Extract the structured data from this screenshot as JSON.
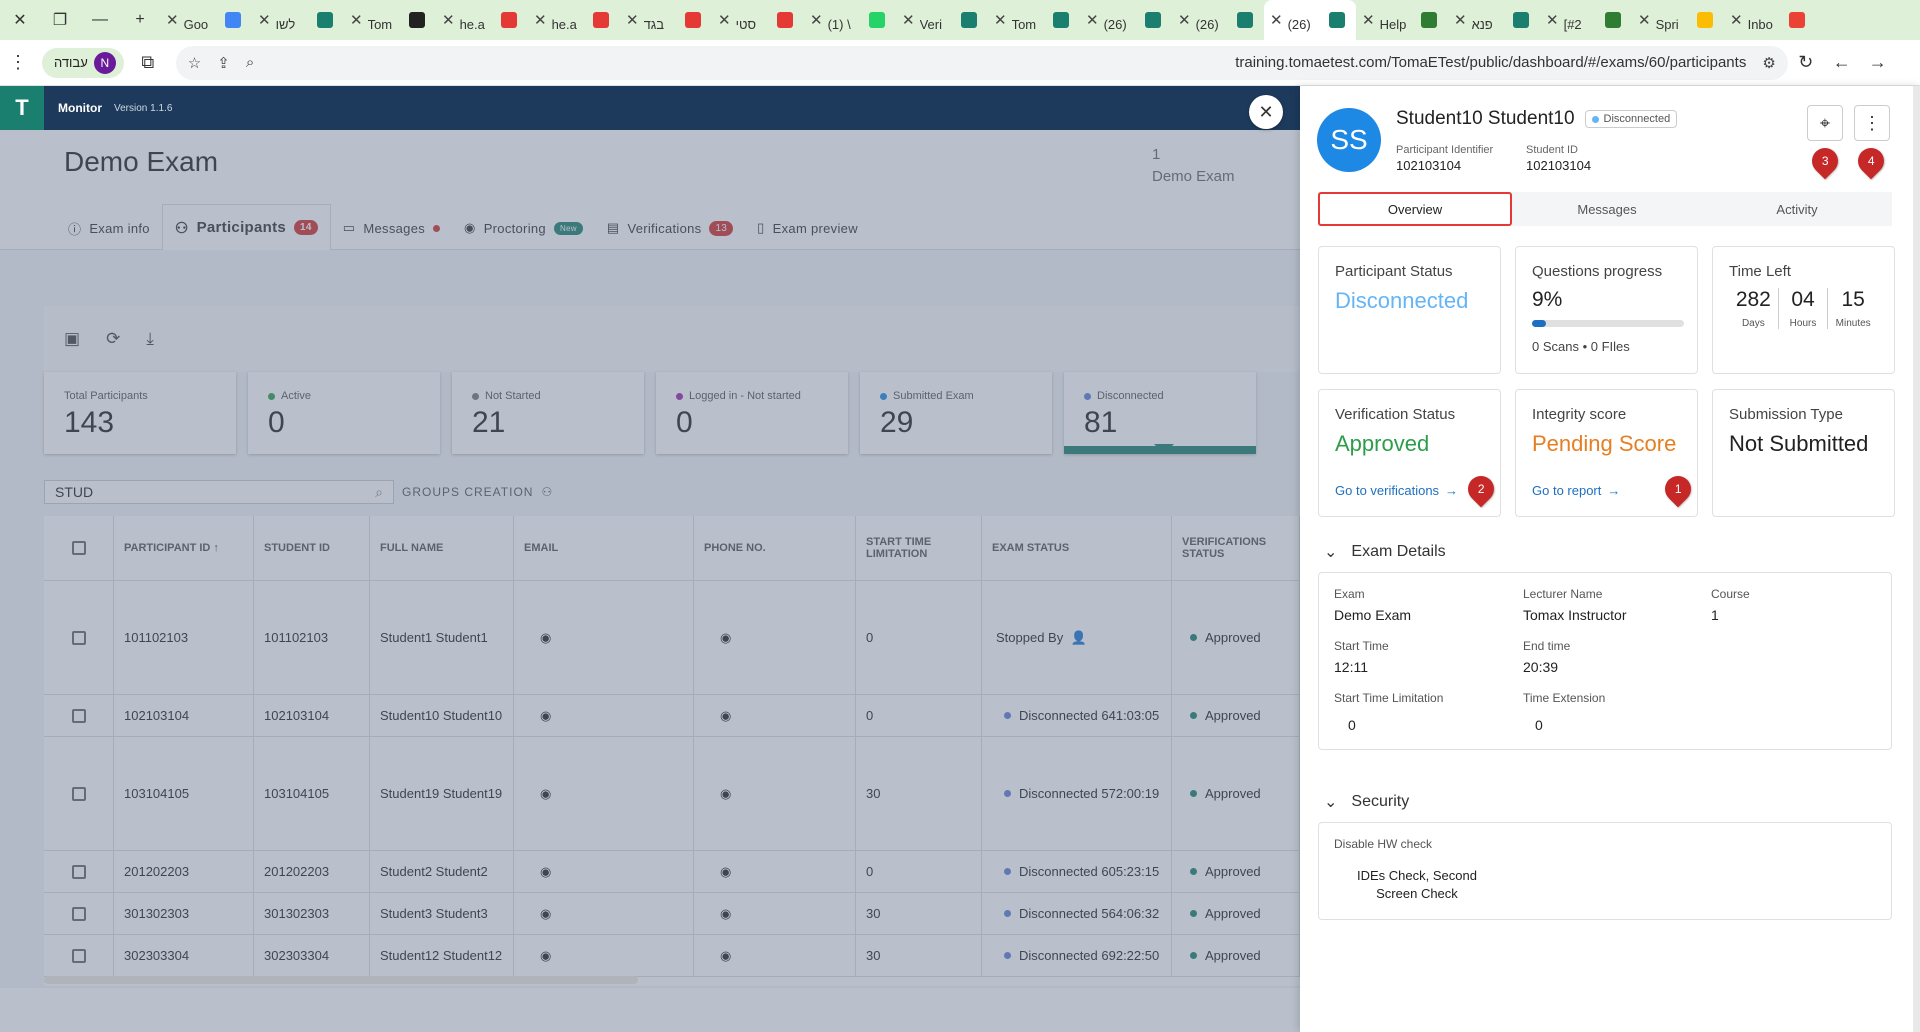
{
  "browser": {
    "tabs": [
      {
        "label": "Goo",
        "color": "#4285f4"
      },
      {
        "label": "לשו",
        "color": "#1a7f6e"
      },
      {
        "label": "Tom",
        "color": "#222222"
      },
      {
        "label": "he.a",
        "color": "#e53935"
      },
      {
        "label": "he.a",
        "color": "#e53935"
      },
      {
        "label": "בגד",
        "color": "#e53935"
      },
      {
        "label": "סטי",
        "color": "#e53935"
      },
      {
        "label": "(1) \\",
        "color": "#25d366"
      },
      {
        "label": "Veri",
        "color": "#1a7f6e"
      },
      {
        "label": "Tom",
        "color": "#1a7f6e"
      },
      {
        "label": "(26)",
        "color": "#1a7f6e"
      },
      {
        "label": "(26)",
        "color": "#1a7f6e"
      },
      {
        "label": "(26)",
        "color": "#1a7f6e",
        "active": true
      },
      {
        "label": "Help",
        "color": "#2e7d32"
      },
      {
        "label": "פנא",
        "color": "#1a7f6e"
      },
      {
        "label": "[#2",
        "color": "#2e7d32"
      },
      {
        "label": "Spri",
        "color": "#fbbc04"
      },
      {
        "label": "Inbo",
        "color": "#ea4335"
      }
    ],
    "profile_label": "עבודה",
    "profile_initial": "N",
    "url": "training.tomaetest.com/TomaETest/public/dashboard/#/exams/60/participants"
  },
  "app": {
    "nav_title": "Monitor",
    "version": "Version 1.1.6",
    "exam_title": "Demo Exam",
    "exam_meta_num": "1",
    "exam_meta_name": "Demo Exam",
    "tabs": [
      {
        "label": "Exam info"
      },
      {
        "label": "Participants",
        "badge": "14"
      },
      {
        "label": "Messages"
      },
      {
        "label": "Proctoring",
        "badge": "New"
      },
      {
        "label": "Verifications",
        "badge": "13"
      },
      {
        "label": "Exam preview"
      }
    ],
    "stats": [
      {
        "label": "Total Participants",
        "value": "143",
        "color": ""
      },
      {
        "label": "Active",
        "value": "0",
        "color": "#2e9d4a"
      },
      {
        "label": "Not Started",
        "value": "21",
        "color": "#777777"
      },
      {
        "label": "Logged in - Not started",
        "value": "0",
        "color": "#9c27b0"
      },
      {
        "label": "Submitted Exam",
        "value": "29",
        "color": "#1e88e5"
      },
      {
        "label": "Disconnected",
        "value": "81",
        "color": "#5b7fd6"
      }
    ],
    "search_value": "STUD",
    "groups_label": "GROUPS CREATION",
    "columns": [
      "PARTICIPANT ID",
      "STUDENT ID",
      "FULL NAME",
      "EMAIL",
      "PHONE NO.",
      "START TIME LIMITATION",
      "EXAM STATUS",
      "VERIFICATIONS STATUS"
    ],
    "rows": [
      {
        "pid": "101102103",
        "sid": "101102103",
        "name": "Student1 Student1",
        "stl": "0",
        "status": "Stopped By",
        "verif": "Approved"
      },
      {
        "pid": "102103104",
        "sid": "102103104",
        "name": "Student10 Student10",
        "stl": "0",
        "status": "Disconnected 641:03:05",
        "verif": "Approved"
      },
      {
        "pid": "103104105",
        "sid": "103104105",
        "name": "Student19 Student19",
        "stl": "30",
        "status": "Disconnected 572:00:19",
        "verif": "Approved"
      },
      {
        "pid": "201202203",
        "sid": "201202203",
        "name": "Student2 Student2",
        "stl": "0",
        "status": "Disconnected 605:23:15",
        "verif": "Approved"
      },
      {
        "pid": "301302303",
        "sid": "301302303",
        "name": "Student3 Student3",
        "stl": "30",
        "status": "Disconnected 564:06:32",
        "verif": "Approved"
      },
      {
        "pid": "302303304",
        "sid": "302303304",
        "name": "Student12 Student12",
        "stl": "30",
        "status": "Disconnected 692:22:50",
        "verif": "Approved"
      }
    ]
  },
  "panel": {
    "initials": "SS",
    "name": "Student10 Student10",
    "status_pill": "Disconnected",
    "participant_identifier_label": "Participant Identifier",
    "participant_identifier": "102103104",
    "student_id_label": "Student ID",
    "student_id": "102103104",
    "tabs": [
      "Overview",
      "Messages",
      "Activity"
    ],
    "participant_status_title": "Participant Status",
    "participant_status": "Disconnected",
    "questions_title": "Questions progress",
    "questions_pct": "9%",
    "questions_fraction": 0.09,
    "scans": "0 Scans",
    "files": "0 FIles",
    "time_left_title": "Time Left",
    "time_left": [
      {
        "n": "282",
        "l": "Days"
      },
      {
        "n": "04",
        "l": "Hours"
      },
      {
        "n": "15",
        "l": "Minutes"
      }
    ],
    "verification_title": "Verification Status",
    "verification_status": "Approved",
    "verification_link": "Go to verifications",
    "integrity_title": "Integrity score",
    "integrity_status": "Pending Score",
    "integrity_link": "Go to report",
    "submission_title": "Submission Type",
    "submission_status": "Not Submitted",
    "exam_details_title": "Exam Details",
    "details": {
      "exam_label": "Exam",
      "exam": "Demo Exam",
      "lecturer_label": "Lecturer Name",
      "lecturer": "Tomax Instructor",
      "course_label": "Course",
      "course": "1",
      "start_label": "Start Time",
      "start": "12:11",
      "end_label": "End time",
      "end": "20:39",
      "stl_label": "Start Time Limitation",
      "stl": "0",
      "ext_label": "Time Extension",
      "ext": "0"
    },
    "security_title": "Security",
    "hw_label": "Disable HW check",
    "hw_value_1": "IDEs Check, Second",
    "hw_value_2": "Screen Check",
    "markers": [
      "1",
      "2",
      "3",
      "4"
    ]
  }
}
